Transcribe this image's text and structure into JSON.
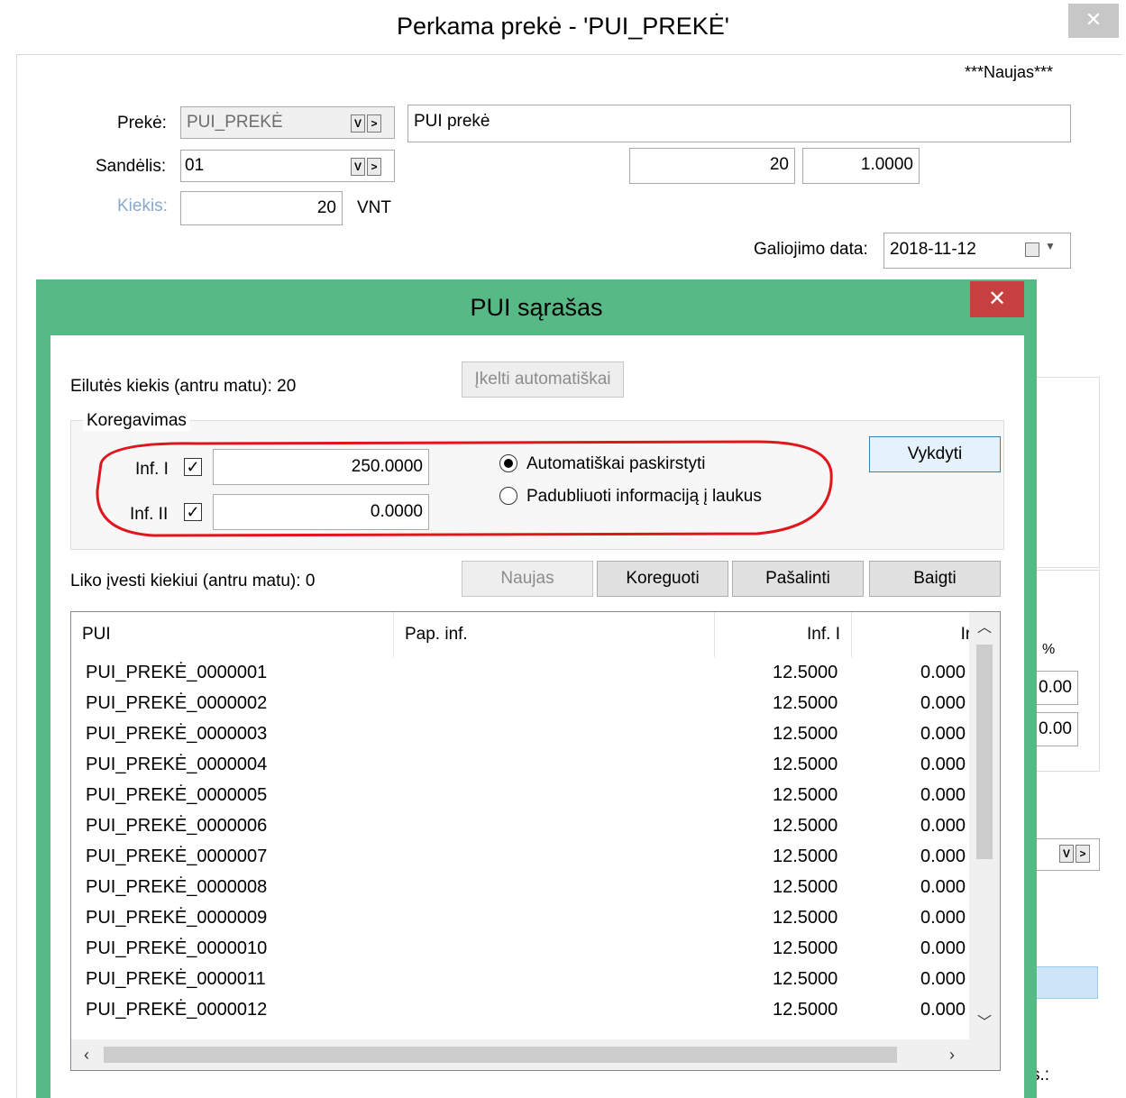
{
  "outer": {
    "title": "Perkama prekė - 'PUI_PREKĖ'",
    "status": "***Naujas***",
    "preke_label": "Prekė:",
    "preke_code": "PUI_PREKĖ",
    "preke_name": "PUI prekė",
    "sandelis_label": "Sandėlis:",
    "sandelis_value": "01",
    "kiekis_label": "Kiekis:",
    "kiekis_value": "20",
    "unit": "VNT",
    "qty2": "20",
    "factor": "1.0000",
    "galiojimo_label": "Galiojimo data:",
    "galiojimo_value": "2018-11-12",
    "behind_percent": "%",
    "behind_val1": "0.00",
    "behind_val2": "0.00",
    "behind_s": "s.:"
  },
  "dialog": {
    "title": "PUI sąrašas",
    "eilutes_label": "Eilutės kiekis (antru matu): 20",
    "ikelti_button": "Įkelti automatiškai",
    "group_label": "Koregavimas",
    "inf1_label": "Inf. I",
    "inf1_value": "250.0000",
    "inf2_label": "Inf. II",
    "inf2_value": "0.0000",
    "radio_auto": "Automatiškai paskirstyti",
    "radio_dup": "Padubliuoti informaciją į laukus",
    "vykdyti_button": "Vykdyti",
    "liko_label": "Liko įvesti kiekiui (antru matu): 0",
    "buttons": {
      "naujas": "Naujas",
      "koreguoti": "Koreguoti",
      "pasalinti": "Pašalinti",
      "baigti": "Baigti"
    },
    "grid": {
      "columns": [
        "PUI",
        "Pap. inf.",
        "Inf. I",
        "Inf."
      ],
      "rows": [
        {
          "pui": "PUI_PREKĖ_0000001",
          "inf1": "12.5000",
          "inf2": "0.000"
        },
        {
          "pui": "PUI_PREKĖ_0000002",
          "inf1": "12.5000",
          "inf2": "0.000"
        },
        {
          "pui": "PUI_PREKĖ_0000003",
          "inf1": "12.5000",
          "inf2": "0.000"
        },
        {
          "pui": "PUI_PREKĖ_0000004",
          "inf1": "12.5000",
          "inf2": "0.000"
        },
        {
          "pui": "PUI_PREKĖ_0000005",
          "inf1": "12.5000",
          "inf2": "0.000"
        },
        {
          "pui": "PUI_PREKĖ_0000006",
          "inf1": "12.5000",
          "inf2": "0.000"
        },
        {
          "pui": "PUI_PREKĖ_0000007",
          "inf1": "12.5000",
          "inf2": "0.000"
        },
        {
          "pui": "PUI_PREKĖ_0000008",
          "inf1": "12.5000",
          "inf2": "0.000"
        },
        {
          "pui": "PUI_PREKĖ_0000009",
          "inf1": "12.5000",
          "inf2": "0.000"
        },
        {
          "pui": "PUI_PREKĖ_0000010",
          "inf1": "12.5000",
          "inf2": "0.000"
        },
        {
          "pui": "PUI_PREKĖ_0000011",
          "inf1": "12.5000",
          "inf2": "0.000"
        },
        {
          "pui": "PUI_PREKĖ_0000012",
          "inf1": "12.5000",
          "inf2": "0.000"
        }
      ]
    }
  },
  "colors": {
    "dialog_frame": "#57b985",
    "close_button": "#c74040",
    "highlight_ellipse": "#e0161e"
  }
}
